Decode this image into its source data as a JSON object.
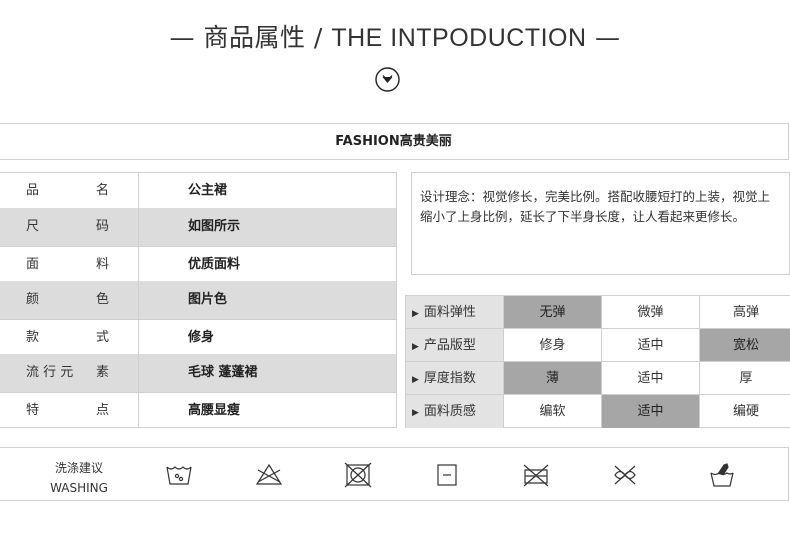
{
  "header": {
    "title_dash_left": "—",
    "title_cn": "商品属性",
    "title_sep": "/",
    "title_en": "THE INTPODUCTION",
    "title_dash_right": "—"
  },
  "fashion_bar": {
    "text": "FASHION高贵美丽"
  },
  "attributes": [
    {
      "k1": "品",
      "k2": "名",
      "value": "公主裙"
    },
    {
      "k1": "尺",
      "k2": "码",
      "value": "如图所示"
    },
    {
      "k1": "面",
      "k2": "料",
      "value": "优质面料"
    },
    {
      "k1": "颜",
      "k2": "色",
      "value": "图片色"
    },
    {
      "k1": "款",
      "k2": "式",
      "value": "修身"
    },
    {
      "k1": "流 行 元",
      "k2": "素",
      "value": "毛球 蓬蓬裙"
    },
    {
      "k1": "特",
      "k2": "点",
      "value": "高腰显瘦"
    }
  ],
  "design": {
    "text": "设计理念：视觉修长，完美比例。搭配收腰短打的上装，视觉上缩小了上身比例，延长了下半身长度，让人看起来更修长。"
  },
  "features": [
    {
      "label": "面料弹性",
      "options": [
        "无弹",
        "微弹",
        "高弹"
      ],
      "selected": 0
    },
    {
      "label": "产品版型",
      "options": [
        "修身",
        "适中",
        "宽松"
      ],
      "selected": 2
    },
    {
      "label": "厚度指数",
      "options": [
        "薄",
        "适中",
        "厚"
      ],
      "selected": 0
    },
    {
      "label": "面料质感",
      "options": [
        "编软",
        "适中",
        "编硬"
      ],
      "selected": 1
    }
  ],
  "washing": {
    "label_cn": "洗涤建议",
    "label_en": "WASHING",
    "icons": [
      "wash-30-icon",
      "do-not-bleach-icon",
      "do-not-tumble-dry-icon",
      "line-dry-icon",
      "do-not-iron-icon",
      "do-not-dry-clean-icon",
      "hand-wash-icon"
    ]
  },
  "colors": {
    "selected": "#a6a6a6",
    "shade": "#dcdcdc",
    "border": "#cfcfcf"
  }
}
